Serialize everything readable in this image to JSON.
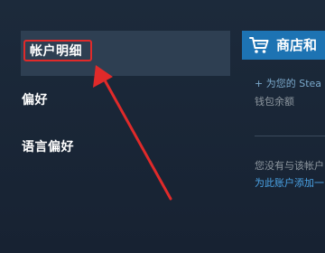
{
  "sidebar": {
    "items": [
      {
        "label": "帐户明细",
        "active": true
      },
      {
        "label": "偏好"
      },
      {
        "label": "语言偏好"
      }
    ]
  },
  "store_panel": {
    "title": "商店和",
    "add_funds_link": "+ 为您的 Stea",
    "wallet_balance_label": "钱包余额",
    "phone_notice": "您没有与该帐户",
    "add_phone_link": "为此账户添加一"
  },
  "colors": {
    "background": "#1b2838",
    "active_item": "#2e3f52",
    "store_header": "#1d73b3",
    "annotation": "#e02a2a",
    "link": "#4aa3e6"
  },
  "icons": {
    "cart": "shopping-cart-icon"
  }
}
